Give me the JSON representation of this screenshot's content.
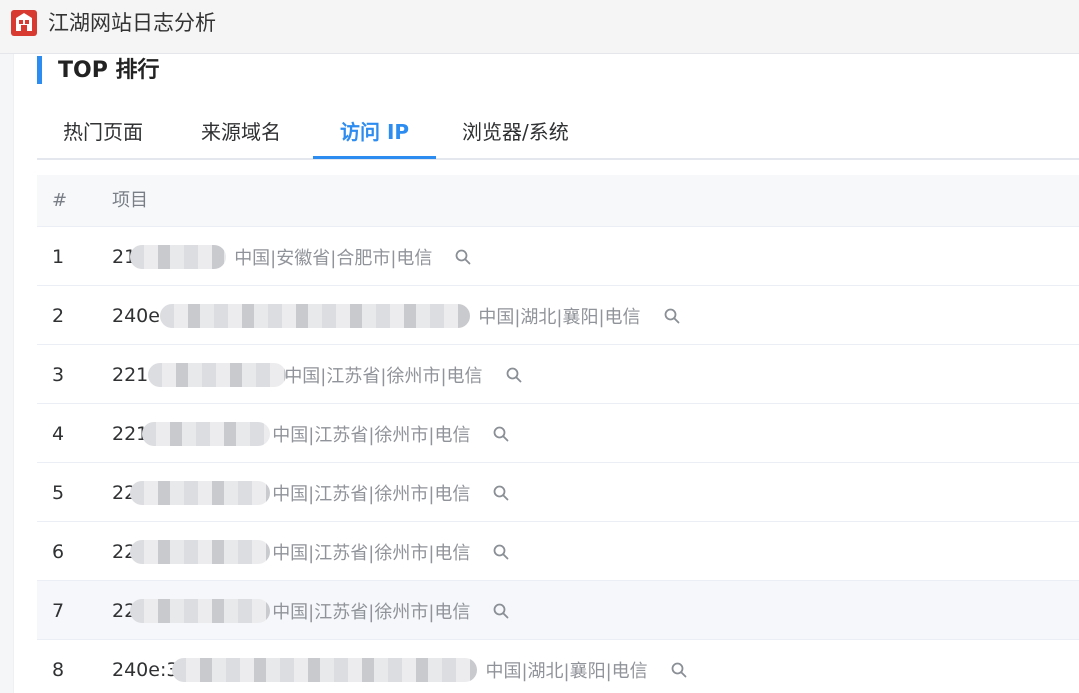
{
  "app": {
    "title": "江湖网站日志分析"
  },
  "section": {
    "title": "TOP 排行"
  },
  "tabs": [
    {
      "label": "热门页面",
      "active": false
    },
    {
      "label": "来源域名",
      "active": false
    },
    {
      "label": "访问 IP",
      "active": true
    },
    {
      "label": "浏览器/系统",
      "active": false
    }
  ],
  "table": {
    "headers": {
      "index": "#",
      "item": "项目"
    },
    "rows": [
      {
        "index": "1",
        "ip": "21",
        "location": "中国|安徽省|合肥市|电信",
        "icon": "search-icon"
      },
      {
        "index": "2",
        "ip": "240e:",
        "location": "中国|湖北|襄阳|电信",
        "icon": "search-icon"
      },
      {
        "index": "3",
        "ip": "221.",
        "location": "中国|江苏省|徐州市|电信",
        "icon": "search-icon"
      },
      {
        "index": "4",
        "ip": "221",
        "location": "中国|江苏省|徐州市|电信",
        "icon": "search-icon"
      },
      {
        "index": "5",
        "ip": "22",
        "location": "中国|江苏省|徐州市|电信",
        "icon": "search-icon"
      },
      {
        "index": "6",
        "ip": "22",
        "location": "中国|江苏省|徐州市|电信",
        "icon": "search-icon"
      },
      {
        "index": "7",
        "ip": "22",
        "location": "中国|江苏省|徐州市|电信",
        "icon": "search-icon"
      },
      {
        "index": "8",
        "ip": "240e:3",
        "location": "中国|湖北|襄阳|电信",
        "icon": "search-icon"
      }
    ]
  },
  "colors": {
    "accent": "#2d8cf0",
    "muted_text": "#909399",
    "hover_row": "#f5f7fa"
  }
}
